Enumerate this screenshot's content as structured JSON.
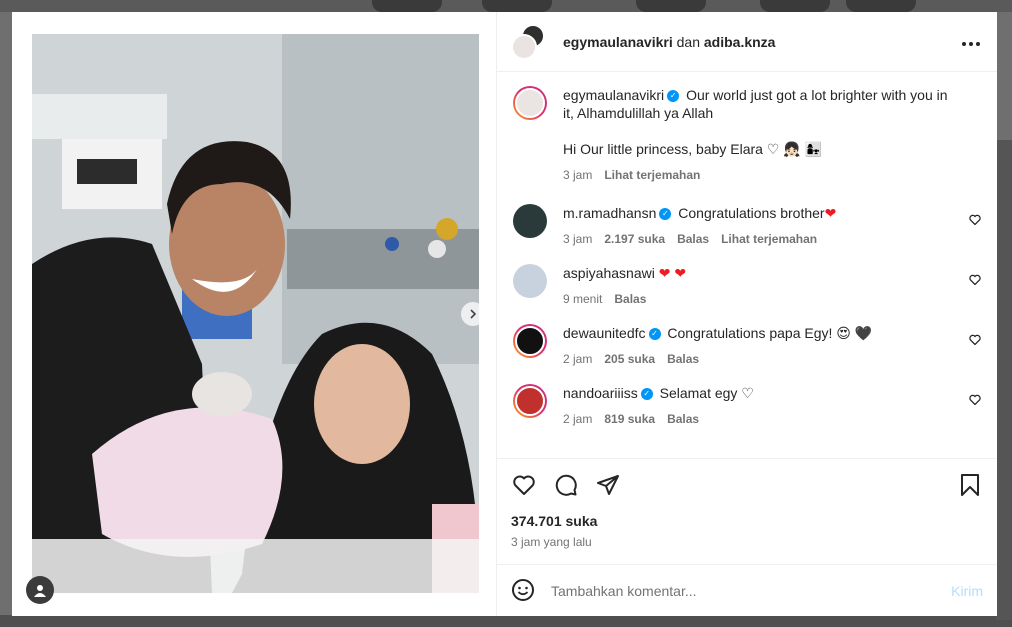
{
  "header": {
    "user1": "egymaulanavikri",
    "connector": "dan",
    "user2": "adiba.knza"
  },
  "caption": {
    "user": "egymaulanavikri",
    "text1": "Our world just got a lot brighter with you in it, Alhamdulillah ya Allah",
    "text2": "Hi Our little princess, baby Elara ♡ 👧🏻 👩‍👧",
    "time": "3 jam",
    "translate": "Lihat terjemahan"
  },
  "comments": [
    {
      "user": "m.ramadhansn",
      "verified": true,
      "text": "Congratulations brother",
      "emoji": "❤",
      "time": "3 jam",
      "likes": "2.197 suka",
      "reply": "Balas",
      "translate": "Lihat terjemahan"
    },
    {
      "user": "aspiyahasnawi",
      "verified": false,
      "text": "",
      "emoji": "❤ ❤",
      "time": "9 menit",
      "reply": "Balas"
    },
    {
      "user": "dewaunitedfc",
      "verified": true,
      "text": "Congratulations papa Egy!",
      "emoji": "😍 🖤",
      "time": "2 jam",
      "likes": "205 suka",
      "reply": "Balas"
    },
    {
      "user": "nandoariiiss",
      "verified": true,
      "text": "Selamat egy",
      "emoji": "♡",
      "time": "2 jam",
      "likes": "819 suka",
      "reply": "Balas"
    }
  ],
  "likes_count": "374.701 suka",
  "posted_time": "3 jam yang lalu",
  "add_comment": {
    "placeholder": "Tambahkan komentar...",
    "send": "Kirim"
  },
  "colors": {
    "verified": "#0095f6",
    "accent_light": "#b2dffc",
    "heart": "#ed1c24"
  }
}
